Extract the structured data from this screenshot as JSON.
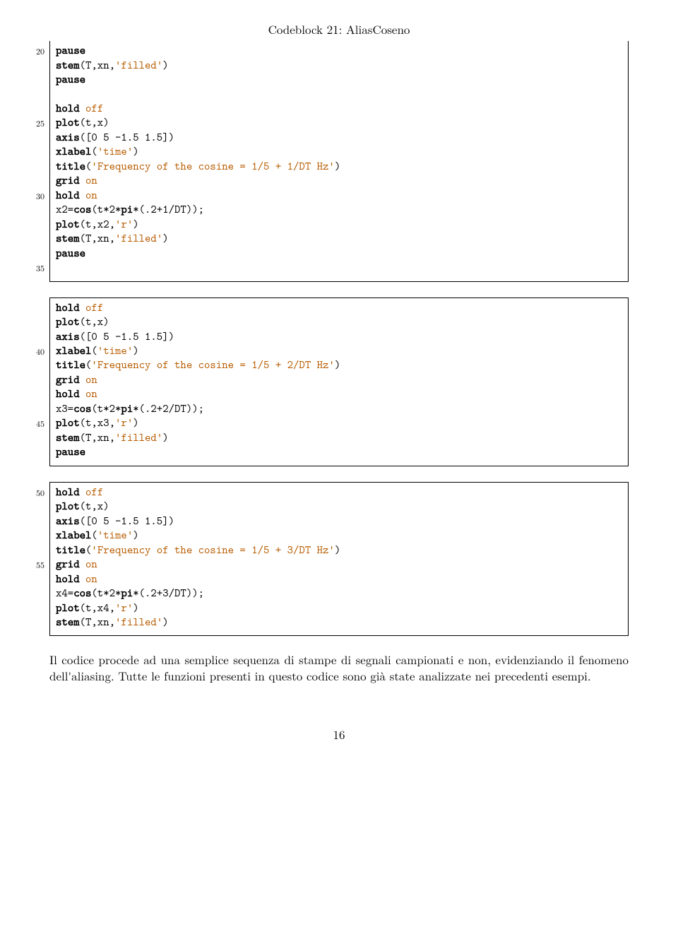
{
  "caption": "Codeblock 21: AliasCoseno",
  "pagenum": "16",
  "paragraph": "Il codice procede ad una semplice sequenza di stampe di segnali campionati e non, evidenziando il fenomeno dell'aliasing. Tutte le funzioni presenti in questo codice sono già state analizzate nei precedenti esempi.",
  "blocks": [
    {
      "border": "no-top",
      "lines": [
        {
          "n": "20",
          "tokens": [
            [
              "kw",
              "pause"
            ]
          ]
        },
        {
          "n": "",
          "tokens": [
            [
              "kw",
              "stem"
            ],
            [
              "",
              "(T,xn,"
            ],
            [
              "str",
              "'filled'"
            ],
            [
              "",
              ")"
            ]
          ]
        },
        {
          "n": "",
          "tokens": [
            [
              "kw",
              "pause"
            ]
          ]
        },
        {
          "n": "",
          "tokens": []
        },
        {
          "n": "",
          "tokens": [
            [
              "kw",
              "hold"
            ],
            [
              "",
              " "
            ],
            [
              "str",
              "off"
            ]
          ]
        },
        {
          "n": "25",
          "tokens": [
            [
              "kw",
              "plot"
            ],
            [
              "",
              "(t,x)"
            ]
          ]
        },
        {
          "n": "",
          "tokens": [
            [
              "kw",
              "axis"
            ],
            [
              "",
              "([0 5 -1.5 1.5])"
            ]
          ]
        },
        {
          "n": "",
          "tokens": [
            [
              "kw",
              "xlabel"
            ],
            [
              "",
              "("
            ],
            [
              "str",
              "'time'"
            ],
            [
              "",
              ")"
            ]
          ]
        },
        {
          "n": "",
          "tokens": [
            [
              "kw",
              "title"
            ],
            [
              "",
              "("
            ],
            [
              "str",
              "'Frequency of the cosine = 1/5 + 1/DT Hz'"
            ],
            [
              "",
              ")"
            ]
          ]
        },
        {
          "n": "",
          "tokens": [
            [
              "kw",
              "grid"
            ],
            [
              "",
              " "
            ],
            [
              "str",
              "on"
            ]
          ]
        },
        {
          "n": "30",
          "tokens": [
            [
              "kw",
              "hold"
            ],
            [
              "",
              " "
            ],
            [
              "str",
              "on"
            ]
          ]
        },
        {
          "n": "",
          "tokens": [
            [
              "",
              "x2="
            ],
            [
              "kw",
              "cos"
            ],
            [
              "",
              "(t*2*"
            ],
            [
              "kw",
              "pi"
            ],
            [
              "",
              "*(.2+1/DT));"
            ]
          ]
        },
        {
          "n": "",
          "tokens": [
            [
              "kw",
              "plot"
            ],
            [
              "",
              "(t,x2,"
            ],
            [
              "str",
              "'r'"
            ],
            [
              "",
              ")"
            ]
          ]
        },
        {
          "n": "",
          "tokens": [
            [
              "kw",
              "stem"
            ],
            [
              "",
              "(T,xn,"
            ],
            [
              "str",
              "'filled'"
            ],
            [
              "",
              ")"
            ]
          ]
        },
        {
          "n": "",
          "tokens": [
            [
              "kw",
              "pause"
            ]
          ]
        },
        {
          "n": "35",
          "tokens": []
        }
      ]
    },
    {
      "border": "full",
      "lines": [
        {
          "n": "",
          "tokens": [
            [
              "kw",
              "hold"
            ],
            [
              "",
              " "
            ],
            [
              "str",
              "off"
            ]
          ]
        },
        {
          "n": "",
          "tokens": [
            [
              "kw",
              "plot"
            ],
            [
              "",
              "(t,x)"
            ]
          ]
        },
        {
          "n": "",
          "tokens": [
            [
              "kw",
              "axis"
            ],
            [
              "",
              "([0 5 -1.5 1.5])"
            ]
          ]
        },
        {
          "n": "40",
          "tokens": [
            [
              "kw",
              "xlabel"
            ],
            [
              "",
              "("
            ],
            [
              "str",
              "'time'"
            ],
            [
              "",
              ")"
            ]
          ]
        },
        {
          "n": "",
          "tokens": [
            [
              "kw",
              "title"
            ],
            [
              "",
              "("
            ],
            [
              "str",
              "'Frequency of the cosine = 1/5 + 2/DT Hz'"
            ],
            [
              "",
              ")"
            ]
          ]
        },
        {
          "n": "",
          "tokens": [
            [
              "kw",
              "grid"
            ],
            [
              "",
              " "
            ],
            [
              "str",
              "on"
            ]
          ]
        },
        {
          "n": "",
          "tokens": [
            [
              "kw",
              "hold"
            ],
            [
              "",
              " "
            ],
            [
              "str",
              "on"
            ]
          ]
        },
        {
          "n": "",
          "tokens": [
            [
              "",
              "x3="
            ],
            [
              "kw",
              "cos"
            ],
            [
              "",
              "(t*2*"
            ],
            [
              "kw",
              "pi"
            ],
            [
              "",
              "*(.2+2/DT));"
            ]
          ]
        },
        {
          "n": "45",
          "tokens": [
            [
              "kw",
              "plot"
            ],
            [
              "",
              "(t,x3,"
            ],
            [
              "str",
              "'r'"
            ],
            [
              "",
              ")"
            ]
          ]
        },
        {
          "n": "",
          "tokens": [
            [
              "kw",
              "stem"
            ],
            [
              "",
              "(T,xn,"
            ],
            [
              "str",
              "'filled'"
            ],
            [
              "",
              ")"
            ]
          ]
        },
        {
          "n": "",
          "tokens": [
            [
              "kw",
              "pause"
            ]
          ]
        }
      ]
    },
    {
      "border": "full",
      "lines": [
        {
          "n": "50",
          "tokens": [
            [
              "kw",
              "hold"
            ],
            [
              "",
              " "
            ],
            [
              "str",
              "off"
            ]
          ]
        },
        {
          "n": "",
          "tokens": [
            [
              "kw",
              "plot"
            ],
            [
              "",
              "(t,x)"
            ]
          ]
        },
        {
          "n": "",
          "tokens": [
            [
              "kw",
              "axis"
            ],
            [
              "",
              "([0 5 -1.5 1.5])"
            ]
          ]
        },
        {
          "n": "",
          "tokens": [
            [
              "kw",
              "xlabel"
            ],
            [
              "",
              "("
            ],
            [
              "str",
              "'time'"
            ],
            [
              "",
              ")"
            ]
          ]
        },
        {
          "n": "",
          "tokens": [
            [
              "kw",
              "title"
            ],
            [
              "",
              "("
            ],
            [
              "str",
              "'Frequency of the cosine = 1/5 + 3/DT Hz'"
            ],
            [
              "",
              ")"
            ]
          ]
        },
        {
          "n": "55",
          "tokens": [
            [
              "kw",
              "grid"
            ],
            [
              "",
              " "
            ],
            [
              "str",
              "on"
            ]
          ]
        },
        {
          "n": "",
          "tokens": [
            [
              "kw",
              "hold"
            ],
            [
              "",
              " "
            ],
            [
              "str",
              "on"
            ]
          ]
        },
        {
          "n": "",
          "tokens": [
            [
              "",
              "x4="
            ],
            [
              "kw",
              "cos"
            ],
            [
              "",
              "(t*2*"
            ],
            [
              "kw",
              "pi"
            ],
            [
              "",
              "*(.2+3/DT));"
            ]
          ]
        },
        {
          "n": "",
          "tokens": [
            [
              "kw",
              "plot"
            ],
            [
              "",
              "(t,x4,"
            ],
            [
              "str",
              "'r'"
            ],
            [
              "",
              ")"
            ]
          ]
        },
        {
          "n": "",
          "tokens": [
            [
              "kw",
              "stem"
            ],
            [
              "",
              "(T,xn,"
            ],
            [
              "str",
              "'filled'"
            ],
            [
              "",
              ")"
            ]
          ]
        }
      ]
    }
  ]
}
